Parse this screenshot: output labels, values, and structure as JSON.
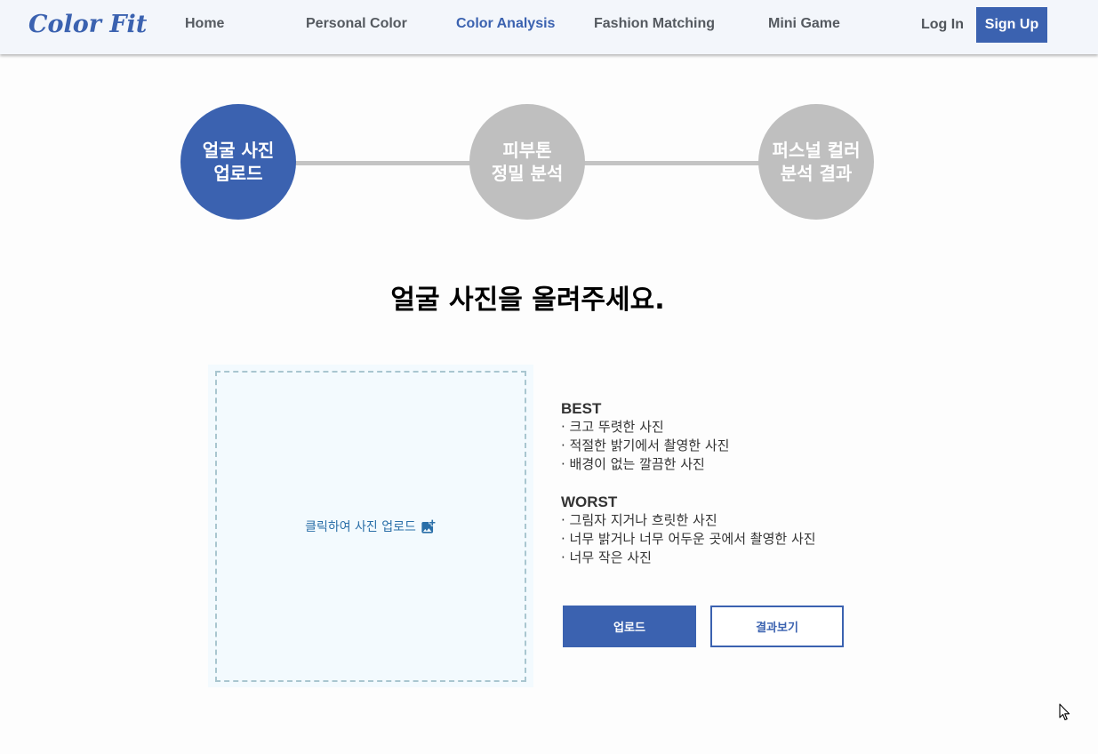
{
  "header": {
    "logo": "Color Fit",
    "nav": [
      {
        "label": "Home"
      },
      {
        "label": "Personal Color"
      },
      {
        "label": "Color Analysis"
      },
      {
        "label": "Fashion Matching"
      },
      {
        "label": "Mini Game"
      }
    ],
    "active_nav": "Color Analysis",
    "login_label": "Log In",
    "signup_label": "Sign Up"
  },
  "steps": [
    {
      "label": "얼굴 사진\n업로드",
      "state": "active"
    },
    {
      "label": "피부톤\n정밀 분석",
      "state": "inactive"
    },
    {
      "label": "퍼스널 컬러\n분석 결과",
      "state": "inactive"
    }
  ],
  "main": {
    "title": "얼굴 사진을 올려주세요.",
    "upload_hint": "클릭하여 사진 업로드",
    "upload_icon": "add-photo-icon",
    "best": {
      "heading": "BEST",
      "items": [
        "· 크고 뚜렷한 사진",
        "· 적절한 밝기에서 촬영한 사진",
        "· 배경이 없는 깔끔한 사진"
      ]
    },
    "worst": {
      "heading": "WORST",
      "items": [
        "· 그림자 지거나 흐릿한 사진",
        "· 너무 밝거나 너무 어두운 곳에서 촬영한 사진",
        "· 너무 작은 사진"
      ]
    },
    "upload_button": "업로드",
    "result_button": "결과보기"
  },
  "colors": {
    "accent": "#3b62b0",
    "inactive_step": "#bfbfbf",
    "upload_bg": "#f3fafe"
  }
}
